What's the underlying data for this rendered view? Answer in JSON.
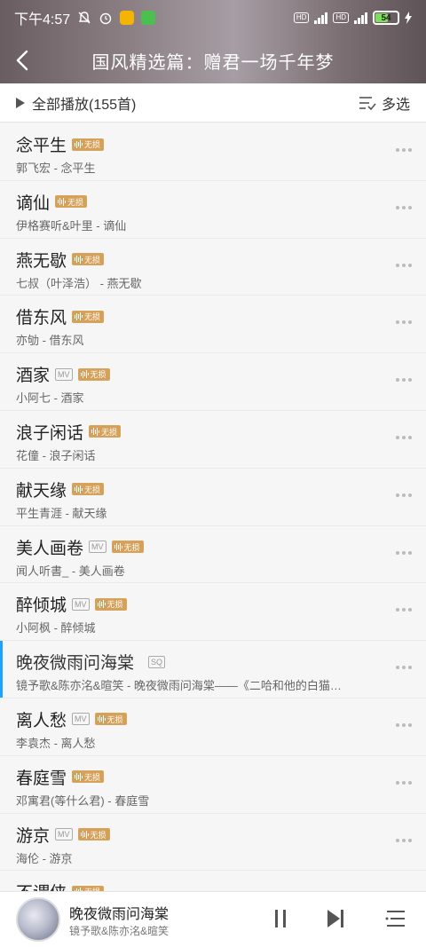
{
  "statusbar": {
    "time": "下午4:57",
    "battery": "54"
  },
  "nav": {
    "title": "国风精选篇：赠君一场千年梦"
  },
  "toolbar": {
    "play_all": "全部播放(155首)",
    "multi_select": "多选"
  },
  "badges": {
    "lossless": "无损",
    "mv": "MV",
    "sq": "SQ"
  },
  "songs": [
    {
      "title": "念平生",
      "artist": "郭飞宏 - 念平生",
      "mv": false,
      "lossless": true
    },
    {
      "title": "谪仙",
      "artist": "伊格赛听&叶里 - 谪仙",
      "mv": false,
      "lossless": true
    },
    {
      "title": "燕无歇",
      "artist": "七叔（叶泽浩） - 燕无歇",
      "mv": false,
      "lossless": true
    },
    {
      "title": "借东风",
      "artist": "亦劬 - 借东风",
      "mv": false,
      "lossless": true
    },
    {
      "title": "酒家",
      "artist": "小阿七 - 酒家",
      "mv": true,
      "lossless": true
    },
    {
      "title": "浪子闲话",
      "artist": "花僮 - 浪子闲话",
      "mv": false,
      "lossless": true
    },
    {
      "title": "献天缘",
      "artist": "平生青涯 - 献天缘",
      "mv": false,
      "lossless": true
    },
    {
      "title": "美人画卷",
      "artist": "闻人听書_ - 美人画卷",
      "mv": true,
      "lossless": true
    },
    {
      "title": "醉倾城",
      "artist": "小阿枫 - 醉倾城",
      "mv": true,
      "lossless": true
    },
    {
      "title": "晚夜微雨问海棠",
      "artist": "镜予歌&陈亦洺&暄笑 - 晚夜微雨问海棠——《二哈和他的白猫…",
      "mv": false,
      "lossless": false,
      "sq": true,
      "active": true
    },
    {
      "title": "离人愁",
      "artist": "李袁杰 - 离人愁",
      "mv": true,
      "lossless": true
    },
    {
      "title": "春庭雪",
      "artist": "邓寓君(等什么君) - 春庭雪",
      "mv": false,
      "lossless": true
    },
    {
      "title": "游京",
      "artist": "海伦 - 游京",
      "mv": true,
      "lossless": true
    },
    {
      "title": "不谓侠",
      "artist": "",
      "mv": false,
      "lossless": true
    }
  ],
  "player": {
    "title": "晚夜微雨问海棠",
    "artist": "镜予歌&陈亦洺&暄笑"
  },
  "colors": {
    "accent": "#1ba3ff",
    "lossless": "#d4a05a"
  }
}
